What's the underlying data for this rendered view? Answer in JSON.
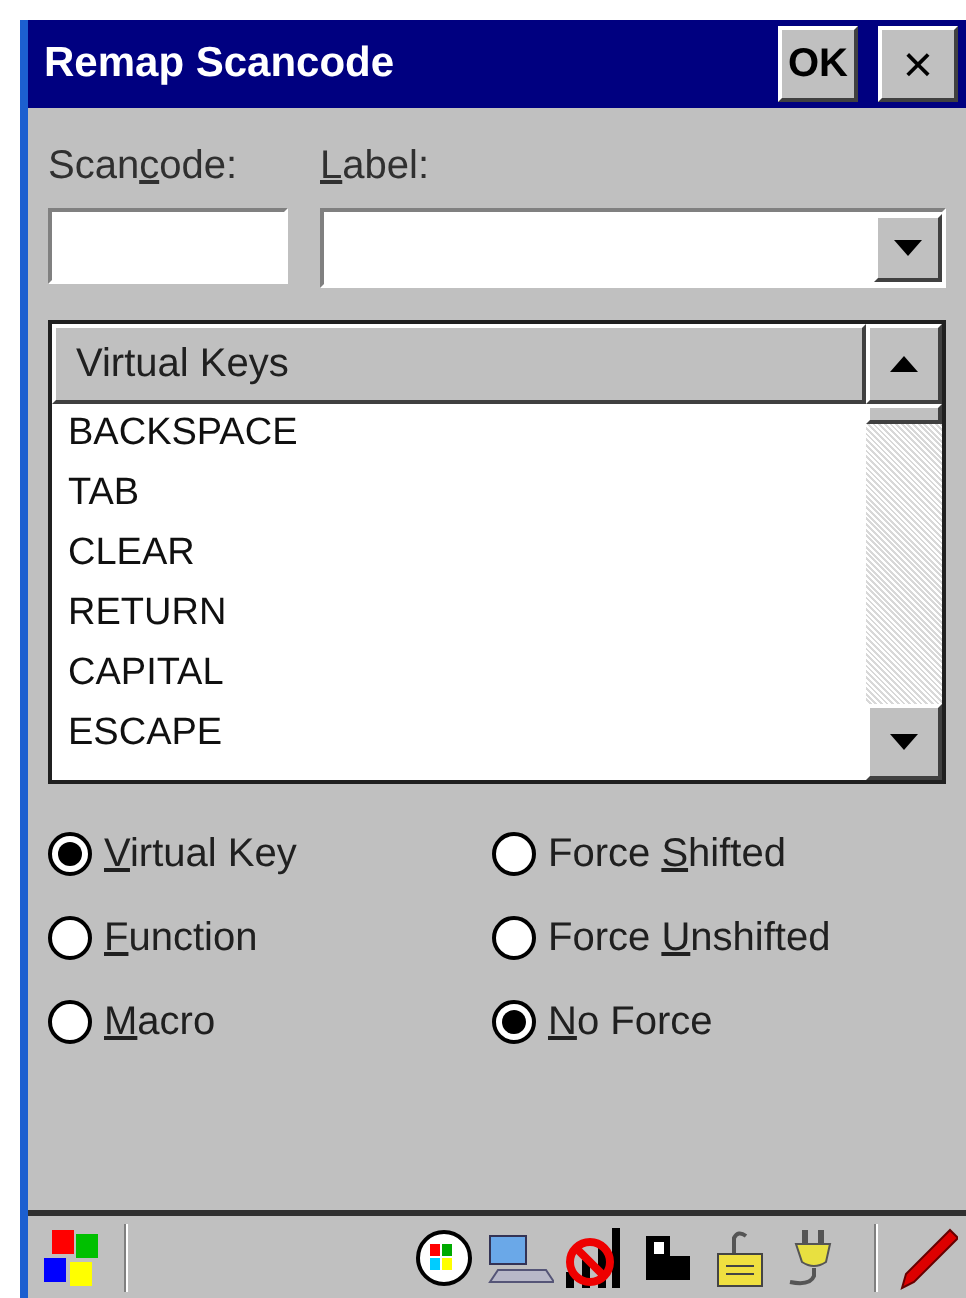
{
  "window": {
    "title": "Remap Scancode",
    "ok_button": "OK",
    "close_button": "×"
  },
  "scancode": {
    "label": [
      {
        "text": "Scan",
        "underlined": false
      },
      {
        "text": "c",
        "underlined": true
      },
      {
        "text": "ode:",
        "underlined": false
      }
    ]
  },
  "label_field": {
    "label": [
      {
        "text": "L",
        "underlined": true
      },
      {
        "text": "abel:",
        "underlined": false
      }
    ]
  },
  "virtual_keys": {
    "header": "Virtual Keys",
    "items": [
      {
        "text": "BACKSPACE",
        "selected": false
      },
      {
        "text": "TAB",
        "selected": false
      },
      {
        "text": "CLEAR",
        "selected": false
      },
      {
        "text": "RETURN",
        "selected": false
      },
      {
        "text": "CAPITAL",
        "selected": false
      },
      {
        "text": "ESCAPE",
        "selected": false
      }
    ]
  },
  "mapping_options": [
    {
      "label": [
        {
          "text": "V",
          "underlined": true
        },
        {
          "text": "irtual Key",
          "underlined": false
        }
      ],
      "selected": true
    },
    {
      "label": [
        {
          "text": "F",
          "underlined": true
        },
        {
          "text": "unction",
          "underlined": false
        }
      ],
      "selected": false
    },
    {
      "label": [
        {
          "text": "M",
          "underlined": true
        },
        {
          "text": "acro",
          "underlined": false
        }
      ],
      "selected": false
    }
  ],
  "force_options": [
    {
      "label": [
        {
          "text": "Force ",
          "underlined": false
        },
        {
          "text": "S",
          "underlined": true
        },
        {
          "text": "hifted",
          "underlined": false
        }
      ],
      "selected": false
    },
    {
      "label": [
        {
          "text": "Force ",
          "underlined": false
        },
        {
          "text": "U",
          "underlined": true
        },
        {
          "text": "nshifted",
          "underlined": false
        }
      ],
      "selected": false
    },
    {
      "label": [
        {
          "text": "N",
          "underlined": true
        },
        {
          "text": "o Force",
          "underlined": false
        }
      ],
      "selected": true
    }
  ]
}
